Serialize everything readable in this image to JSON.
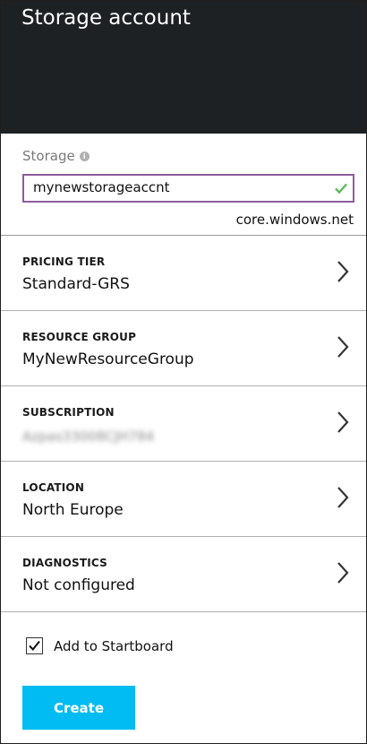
{
  "header": {
    "title": "Storage account"
  },
  "storage": {
    "label": "Storage",
    "info_icon": "info-icon",
    "value": "mynewstorageaccnt",
    "valid_icon": "checkmark-icon",
    "domain_suffix": "core.windows.net"
  },
  "rows": [
    {
      "label": "PRICING TIER",
      "value": "Standard-GRS"
    },
    {
      "label": "RESOURCE GROUP",
      "value": "MyNewResourceGroup"
    },
    {
      "label": "SUBSCRIPTION",
      "value": "Azpas33008CJH784"
    },
    {
      "label": "LOCATION",
      "value": "North Europe"
    },
    {
      "label": "DIAGNOSTICS",
      "value": "Not configured"
    }
  ],
  "startboard": {
    "label": "Add to Startboard",
    "checked": true
  },
  "create_button": {
    "label": "Create"
  },
  "colors": {
    "header_bg": "#1e2124",
    "input_border": "#8e5c9e",
    "check_green": "#5cb85c",
    "create_bg": "#00bcf2"
  }
}
